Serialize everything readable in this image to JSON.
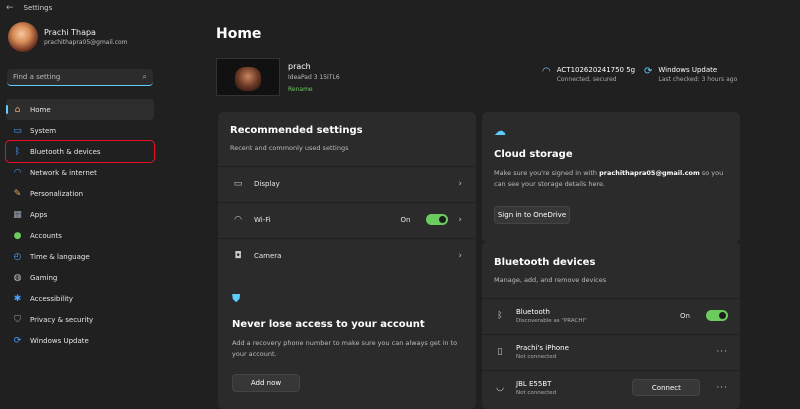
{
  "window": {
    "title": "Settings"
  },
  "profile": {
    "name": "Prachi Thapa",
    "email": "prachithapra05@gmail.com"
  },
  "search": {
    "placeholder": "Find a setting"
  },
  "nav": [
    {
      "label": "Home",
      "icon": "home-icon"
    },
    {
      "label": "System",
      "icon": "system-icon"
    },
    {
      "label": "Bluetooth & devices",
      "icon": "bluetooth-icon"
    },
    {
      "label": "Network & internet",
      "icon": "wifi-icon"
    },
    {
      "label": "Personalization",
      "icon": "brush-icon"
    },
    {
      "label": "Apps",
      "icon": "apps-icon"
    },
    {
      "label": "Accounts",
      "icon": "person-icon"
    },
    {
      "label": "Time & language",
      "icon": "globe-clock-icon"
    },
    {
      "label": "Gaming",
      "icon": "gamepad-icon"
    },
    {
      "label": "Accessibility",
      "icon": "accessibility-icon"
    },
    {
      "label": "Privacy & security",
      "icon": "shield-icon"
    },
    {
      "label": "Windows Update",
      "icon": "update-icon"
    }
  ],
  "page": {
    "title": "Home"
  },
  "device": {
    "name": "prach",
    "model": "IdeaPad 3 15ITL6",
    "rename": "Rename"
  },
  "network": {
    "name": "ACT102620241750 5g",
    "status": "Connected, secured"
  },
  "update": {
    "title": "Windows Update",
    "status": "Last checked: 3 hours ago"
  },
  "recommended": {
    "title": "Recommended settings",
    "subtitle": "Recent and commonly used settings",
    "rows": [
      {
        "label": "Display"
      },
      {
        "label": "Wi-Fi",
        "state": "On"
      },
      {
        "label": "Camera"
      }
    ]
  },
  "account_card": {
    "title": "Never lose access to your account",
    "body": "Add a recovery phone number to make sure you can always get in to your account.",
    "button": "Add now"
  },
  "cloud": {
    "title": "Cloud storage",
    "body_prefix": "Make sure you're signed in with ",
    "email": "prachithapra05@gmail.com",
    "body_suffix": " so you can see your storage details here.",
    "button": "Sign in to OneDrive"
  },
  "bluetooth": {
    "title": "Bluetooth devices",
    "subtitle": "Manage, add, and remove devices",
    "rows": [
      {
        "name": "Bluetooth",
        "status": "Discoverable as \"PRACHI\"",
        "state": "On"
      },
      {
        "name": "Prachi's iPhone",
        "status": "Not connected"
      },
      {
        "name": "JBL E55BT",
        "status": "Not connected",
        "button": "Connect"
      }
    ]
  },
  "colors": {
    "accent": "#60cdff",
    "toggle_on": "#6ccb5f",
    "highlight": "#e81123"
  }
}
